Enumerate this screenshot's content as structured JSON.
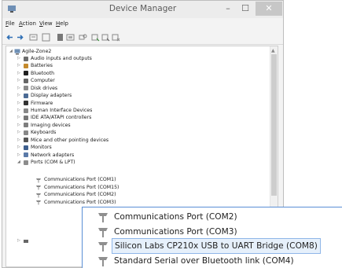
{
  "window": {
    "title": "Device Manager",
    "min_glyph": "–",
    "max_glyph": "☐",
    "close_glyph": "✕"
  },
  "menu": [
    {
      "key": "F",
      "rest": "ile"
    },
    {
      "key": "A",
      "rest": "ction"
    },
    {
      "key": "V",
      "rest": "iew"
    },
    {
      "key": "H",
      "rest": "elp"
    }
  ],
  "toolbar": [
    "back-icon",
    "forward-icon",
    "properties-icon",
    "help-icon",
    "view-icon",
    "update-driver-icon",
    "scan-icon",
    "enable-icon",
    "disable-icon",
    "uninstall-icon"
  ],
  "tree": {
    "root": "Agile-Zone2",
    "categories": [
      "Audio inputs and outputs",
      "Batteries",
      "Bluetooth",
      "Computer",
      "Disk drives",
      "Display adapters",
      "Firmware",
      "Human Interface Devices",
      "IDE ATA/ATAPI controllers",
      "Imaging devices",
      "Keyboards",
      "Mice and other pointing devices",
      "Monitors",
      "Network adapters",
      "Ports (COM & LPT)"
    ],
    "ports": [
      "Communications Port (COM1)",
      "Communications Port (COM15)",
      "Communications Port (COM2)",
      "Communications Port (COM3)"
    ]
  },
  "zoom": {
    "items": [
      "Communications Port (COM2)",
      "Communications Port (COM3)",
      "Silicon Labs CP210x USB to UART Bridge (COM8)",
      "Standard Serial over Bluetooth link (COM4)"
    ],
    "selected_index": 2
  },
  "colors": {
    "selection_border": "#8fb6e8",
    "selection_fill": "#e6f0fb",
    "zoom_border": "#5a8fd6"
  }
}
